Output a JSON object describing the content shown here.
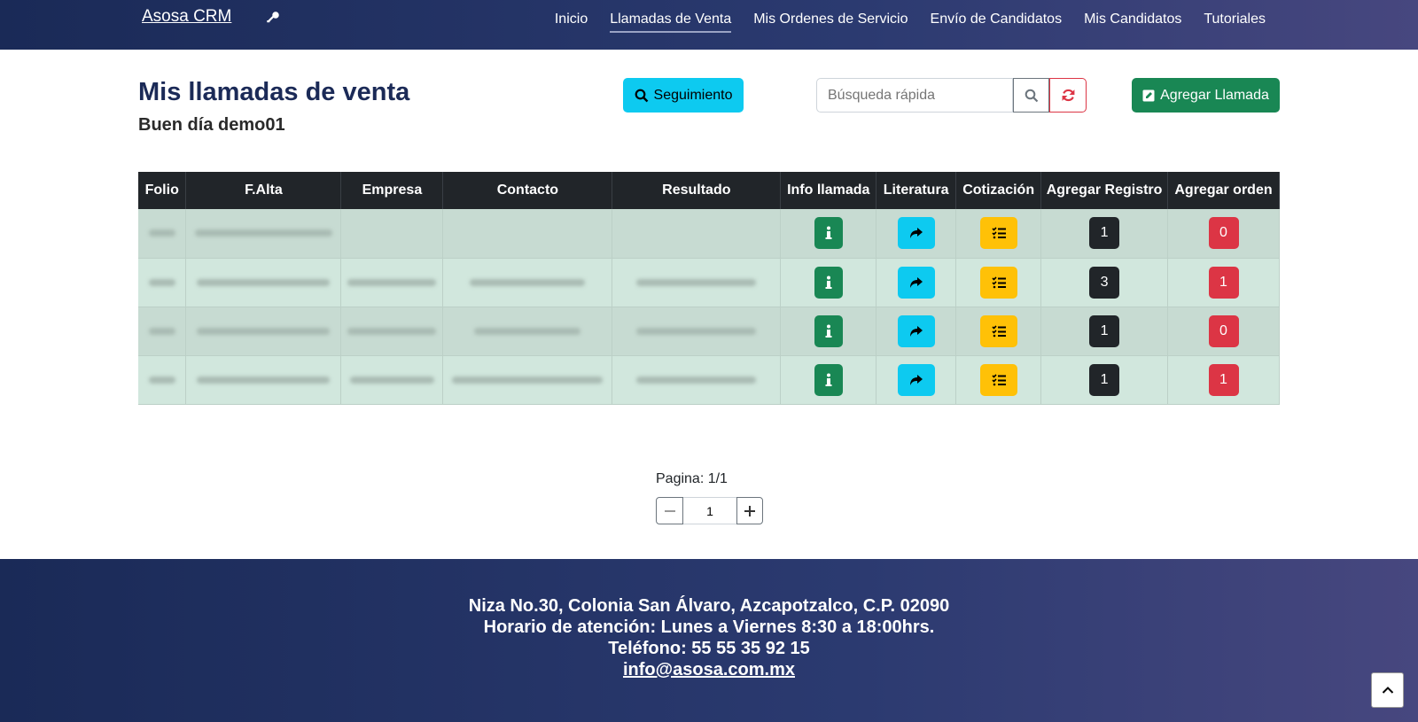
{
  "navbar": {
    "brand": "Asosa CRM",
    "links": [
      {
        "label": "Inicio",
        "active": false
      },
      {
        "label": "Llamadas de Venta",
        "active": true
      },
      {
        "label": "Mis Ordenes de Servicio",
        "active": false
      },
      {
        "label": "Envío de Candidatos",
        "active": false
      },
      {
        "label": "Mis Candidatos",
        "active": false
      },
      {
        "label": "Tutoriales",
        "active": false
      }
    ]
  },
  "header": {
    "title": "Mis llamadas de venta",
    "greeting": "Buen día demo01",
    "follow_label": "Seguimiento",
    "search_placeholder": "Búsqueda rápida",
    "add_label": "Agregar Llamada"
  },
  "table": {
    "columns": [
      "Folio",
      "F.Alta",
      "Empresa",
      "Contacto",
      "Resultado",
      "Info llamada",
      "Literatura",
      "Cotización",
      "Agregar Registro",
      "Agregar orden"
    ],
    "rows": [
      {
        "registros": "1",
        "ordenes": "0"
      },
      {
        "registros": "3",
        "ordenes": "1"
      },
      {
        "registros": "1",
        "ordenes": "0"
      },
      {
        "registros": "1",
        "ordenes": "1"
      }
    ]
  },
  "pagination": {
    "label": "Pagina: 1/1",
    "value": "1"
  },
  "footer": {
    "address": "Niza No.30, Colonia San Álvaro, Azcapotzalco, C.P. 02090",
    "hours": "Horario de atención: Lunes a Viernes 8:30 a 18:00hrs.",
    "phone": "Teléfono: 55 55 35 92 15",
    "email": "info@asosa.com.mx"
  },
  "colors": {
    "navbar": "#1a2a57",
    "info_button": "#198754",
    "literature_button": "#0dcaf0",
    "quote_button": "#ffc107",
    "orders_badge": "#dc3545",
    "records_badge": "#212529"
  },
  "icons": {
    "brand": "key-icon",
    "follow": "search-icon",
    "search": "search-icon",
    "refresh": "refresh-icon",
    "add": "edit-icon",
    "info": "info-icon",
    "literature": "share-icon",
    "quote": "list-check-icon",
    "scroll_top": "chevron-up-icon"
  }
}
